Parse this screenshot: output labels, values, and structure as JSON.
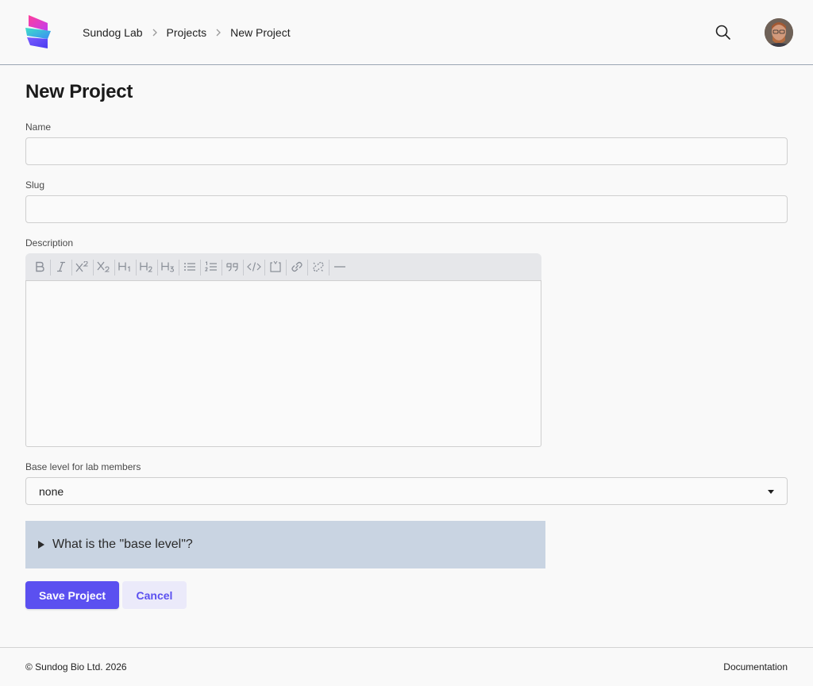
{
  "header": {
    "breadcrumb": [
      "Sundog Lab",
      "Projects",
      "New Project"
    ]
  },
  "page": {
    "title": "New Project"
  },
  "form": {
    "name": {
      "label": "Name",
      "value": ""
    },
    "slug": {
      "label": "Slug",
      "value": ""
    },
    "description": {
      "label": "Description",
      "toolbar": [
        "bold-icon",
        "italic-icon",
        "superscript-icon",
        "subscript-icon",
        "heading-1-icon",
        "heading-2-icon",
        "heading-3-icon",
        "bullet-list-icon",
        "numbered-list-icon",
        "quote-icon",
        "code-icon",
        "code-block-icon",
        "link-icon",
        "unlink-icon",
        "horizontal-rule-icon"
      ]
    },
    "base_level": {
      "label": "Base level for lab members",
      "selected": "none"
    },
    "details_summary": "What is the \"base level\"?",
    "save_label": "Save Project",
    "cancel_label": "Cancel"
  },
  "footer": {
    "copyright": "© Sundog Bio Ltd. 2026",
    "docs_link": "Documentation"
  },
  "colors": {
    "accent": "#5b50f0",
    "details_bg": "#c9d4e2",
    "toolbar_bg": "#e6e7ea"
  }
}
